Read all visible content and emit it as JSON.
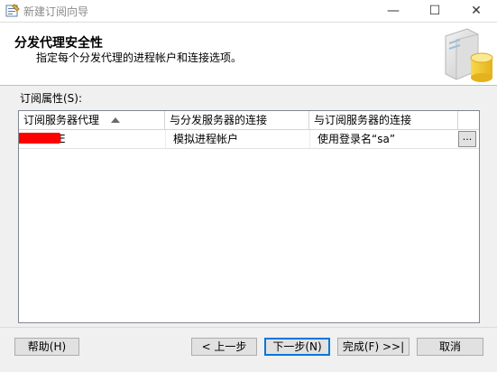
{
  "window": {
    "title": "新建订阅向导",
    "minimize_glyph": "—",
    "maximize_glyph": "☐",
    "close_glyph": "✕"
  },
  "header": {
    "title": "分发代理安全性",
    "subtitle": "指定每个分发代理的进程帐户和连接选项。"
  },
  "subscription_props": {
    "label": "订阅属性(S):",
    "columns": [
      "订阅服务器代理",
      "与分发服务器的连接",
      "与订阅服务器的连接"
    ],
    "sorted_column_index": 0,
    "rows": [
      {
        "agent": "E",
        "distributor_connection": "模拟进程帐户",
        "subscriber_connection": "使用登录名“sa”",
        "ellipsis_label": "..."
      }
    ]
  },
  "buttons": {
    "help": "帮助(H)",
    "back": "< 上一步",
    "next": "下一步(N)",
    "finish": "完成(F) >>|",
    "cancel": "取消"
  },
  "colors": {
    "redaction": "#ff0000",
    "default_button_border": "#0078d7"
  },
  "icons": {
    "app": "wizard-app-icon",
    "header": "database-server-icon",
    "sort": "sort-ascending-icon"
  }
}
